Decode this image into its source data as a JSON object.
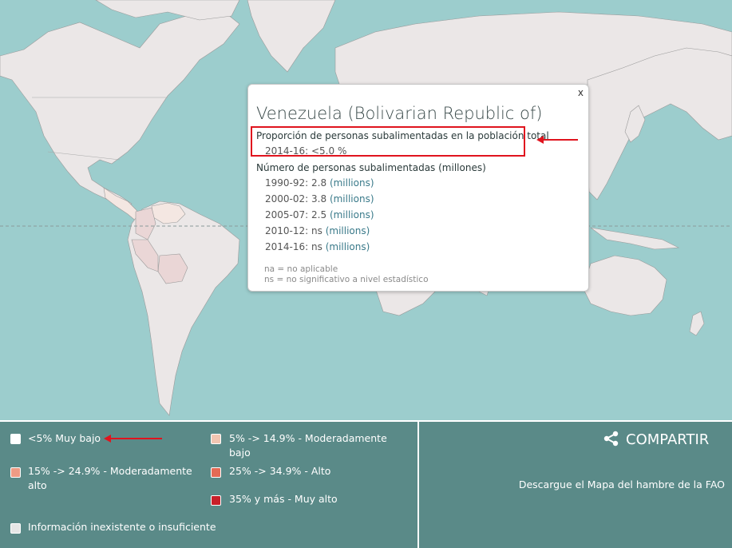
{
  "popup": {
    "close_label": "x",
    "country": "Venezuela (Bolivarian Republic of)",
    "proportion_heading": "Proporción de personas subalimentadas en la población total",
    "proportion_value": "2014-16: <5.0 %",
    "number_heading": "Número de personas subalimentadas (millones)",
    "rows": [
      {
        "period": "1990-92:",
        "value": "2.8",
        "unit": "(millions)"
      },
      {
        "period": "2000-02:",
        "value": "3.8",
        "unit": "(millions)"
      },
      {
        "period": "2005-07:",
        "value": "2.5",
        "unit": "(millions)"
      },
      {
        "period": "2010-12:",
        "value": "ns",
        "unit": "(millions)"
      },
      {
        "period": "2014-16:",
        "value": "ns",
        "unit": "(millions)"
      }
    ],
    "note_na": "na = no aplicable",
    "note_ns": "ns = no significativo a nivel estadístico"
  },
  "legend": {
    "items": [
      {
        "label": "<5% Muy bajo",
        "color": "#ffffff"
      },
      {
        "label": "5% -> 14.9% - Moderadamente bajo",
        "color": "#f3c6b2"
      },
      {
        "label": "15% -> 24.9% - Moderadamente alto",
        "color": "#ee9b85"
      },
      {
        "label": "25% -> 34.9% - Alto",
        "color": "#e46a55"
      },
      {
        "label": "35% y más - Muy alto",
        "color": "#c8202a"
      },
      {
        "label": "Información inexistente o insuficiente",
        "color": "#e6e6e6"
      }
    ]
  },
  "share_label": "COMPARTIR",
  "download_label": "Descargue el Mapa del hambre de la FAO",
  "colors": {
    "ocean": "#9ccdcd",
    "land": "#ebe7e7",
    "legend_bg": "#5a8a88",
    "highlight": "#e0141e"
  }
}
